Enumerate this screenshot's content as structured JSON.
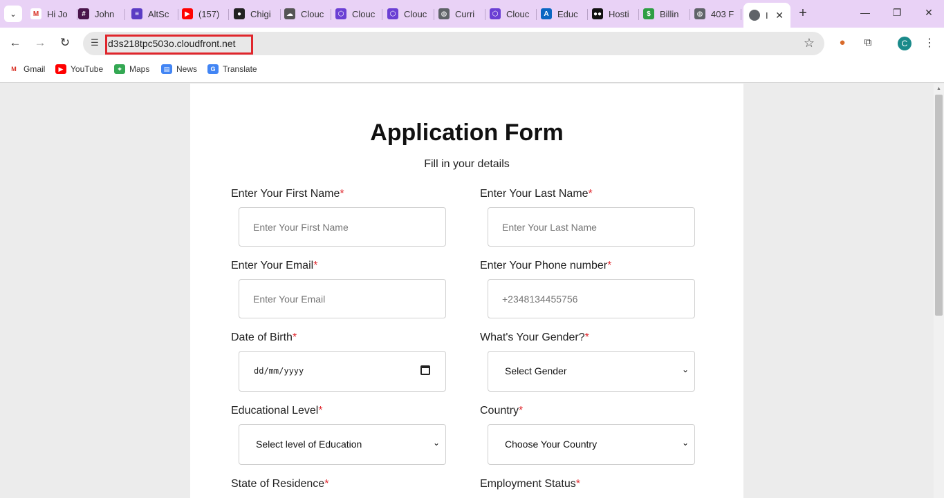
{
  "tabs": [
    {
      "label": "Hi Jo",
      "icon": "gmail-icon",
      "color": "#ffffff"
    },
    {
      "label": "John",
      "icon": "slack-icon",
      "color": "#4a154b"
    },
    {
      "label": "AltSc",
      "icon": "altschool-icon",
      "color": "#5b3cc4"
    },
    {
      "label": "(157)",
      "icon": "youtube-icon",
      "color": "#ff0000"
    },
    {
      "label": "Chigi",
      "icon": "github-icon",
      "color": "#222222"
    },
    {
      "label": "Clouc",
      "icon": "cloud-icon",
      "color": "#555555"
    },
    {
      "label": "Clouc",
      "icon": "hexagon-icon",
      "color": "#6b3fd4"
    },
    {
      "label": "Clouc",
      "icon": "hexagon-icon",
      "color": "#6b3fd4"
    },
    {
      "label": "Curri",
      "icon": "globe-icon",
      "color": "#5f6368"
    },
    {
      "label": "Clouc",
      "icon": "hexagon-icon",
      "color": "#6b3fd4"
    },
    {
      "label": "Educ",
      "icon": "azure-icon",
      "color": "#0a66c2"
    },
    {
      "label": "Hosti",
      "icon": "medium-icon",
      "color": "#111111"
    },
    {
      "label": "Billin",
      "icon": "billing-icon",
      "color": "#2e9e44"
    },
    {
      "label": "403 F",
      "icon": "globe-icon",
      "color": "#5f6368"
    }
  ],
  "active_tab": {
    "label": "I"
  },
  "toolbar": {
    "url": "d3s218tpc503o.cloudfront.net",
    "profile_initial": "C"
  },
  "bookmarks": [
    {
      "label": "Gmail",
      "icon": "gmail-icon"
    },
    {
      "label": "YouTube",
      "icon": "youtube-icon"
    },
    {
      "label": "Maps",
      "icon": "maps-icon"
    },
    {
      "label": "News",
      "icon": "news-icon"
    },
    {
      "label": "Translate",
      "icon": "translate-icon"
    }
  ],
  "form": {
    "title": "Application Form",
    "subtitle": "Fill in your details",
    "required_mark": "*",
    "first_name": {
      "label": "Enter Your First Name",
      "placeholder": "Enter Your First Name"
    },
    "last_name": {
      "label": "Enter Your Last Name",
      "placeholder": "Enter Your Last Name"
    },
    "email": {
      "label": "Enter Your Email",
      "placeholder": "Enter Your Email"
    },
    "phone": {
      "label": "Enter Your Phone number",
      "placeholder": "+2348134455756"
    },
    "dob": {
      "label": "Date of Birth",
      "value": "dd/mm/yyyy"
    },
    "gender": {
      "label": "What's Your Gender?",
      "value": "Select Gender"
    },
    "education": {
      "label": "Educational Level",
      "value": "Select level of Education"
    },
    "country": {
      "label": "Country",
      "value": "Choose Your Country"
    },
    "state": {
      "label": "State of Residence"
    },
    "employment": {
      "label": "Employment Status"
    }
  }
}
